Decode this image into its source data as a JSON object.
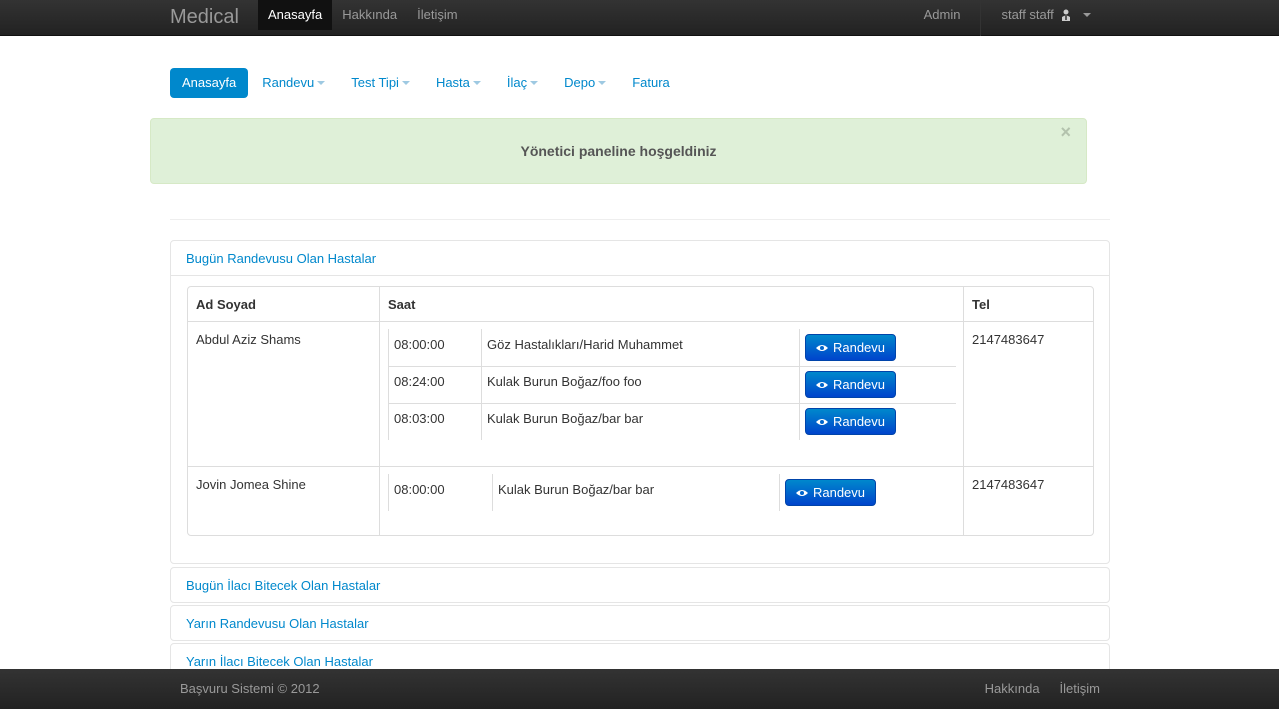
{
  "navbar": {
    "brand": "Medical",
    "items": [
      "Anasayfa",
      "Hakkında",
      "İletişim"
    ],
    "admin": "Admin",
    "user": "staff staff"
  },
  "pills": [
    "Anasayfa",
    "Randevu",
    "Test Tipi",
    "Hasta",
    "İlaç",
    "Depo",
    "Fatura"
  ],
  "alert": {
    "message": "Yönetici paneline hoşgeldiniz",
    "close": "×"
  },
  "accordion": {
    "today_appointments": {
      "title": "Bugün Randevusu Olan Hastalar",
      "columns": {
        "name": "Ad Soyad",
        "time": "Saat",
        "phone": "Tel"
      },
      "patients": [
        {
          "name": "Abdul Aziz Shams",
          "phone": "2147483647",
          "appointments": [
            {
              "time": "08:00:00",
              "desc": "Göz Hastalıkları/Harid Muhammet",
              "button": "Randevu"
            },
            {
              "time": "08:24:00",
              "desc": "Kulak Burun Boğaz/foo foo",
              "button": "Randevu"
            },
            {
              "time": "08:03:00",
              "desc": "Kulak Burun Boğaz/bar bar",
              "button": "Randevu"
            }
          ]
        },
        {
          "name": "Jovin Jomea Shine",
          "phone": "2147483647",
          "appointments": [
            {
              "time": "08:00:00",
              "desc": "Kulak Burun Boğaz/bar bar",
              "button": "Randevu"
            }
          ]
        }
      ]
    },
    "today_medicine": {
      "title": "Bugün İlacı Bitecek Olan Hastalar"
    },
    "tomorrow_appointments": {
      "title": "Yarın Randevusu Olan Hastalar"
    },
    "tomorrow_medicine": {
      "title": "Yarın İlacı Bitecek Olan Hastalar"
    }
  },
  "footer": {
    "copyright": "Başvuru Sistemi © 2012",
    "links": [
      "Hakkında",
      "İletişim"
    ]
  },
  "colors": {
    "primary": "#0088cc",
    "navbar": "#222222",
    "alert_bg": "#dff0d8"
  },
  "icons": {
    "user": "user-icon",
    "eye": "eye-icon"
  }
}
